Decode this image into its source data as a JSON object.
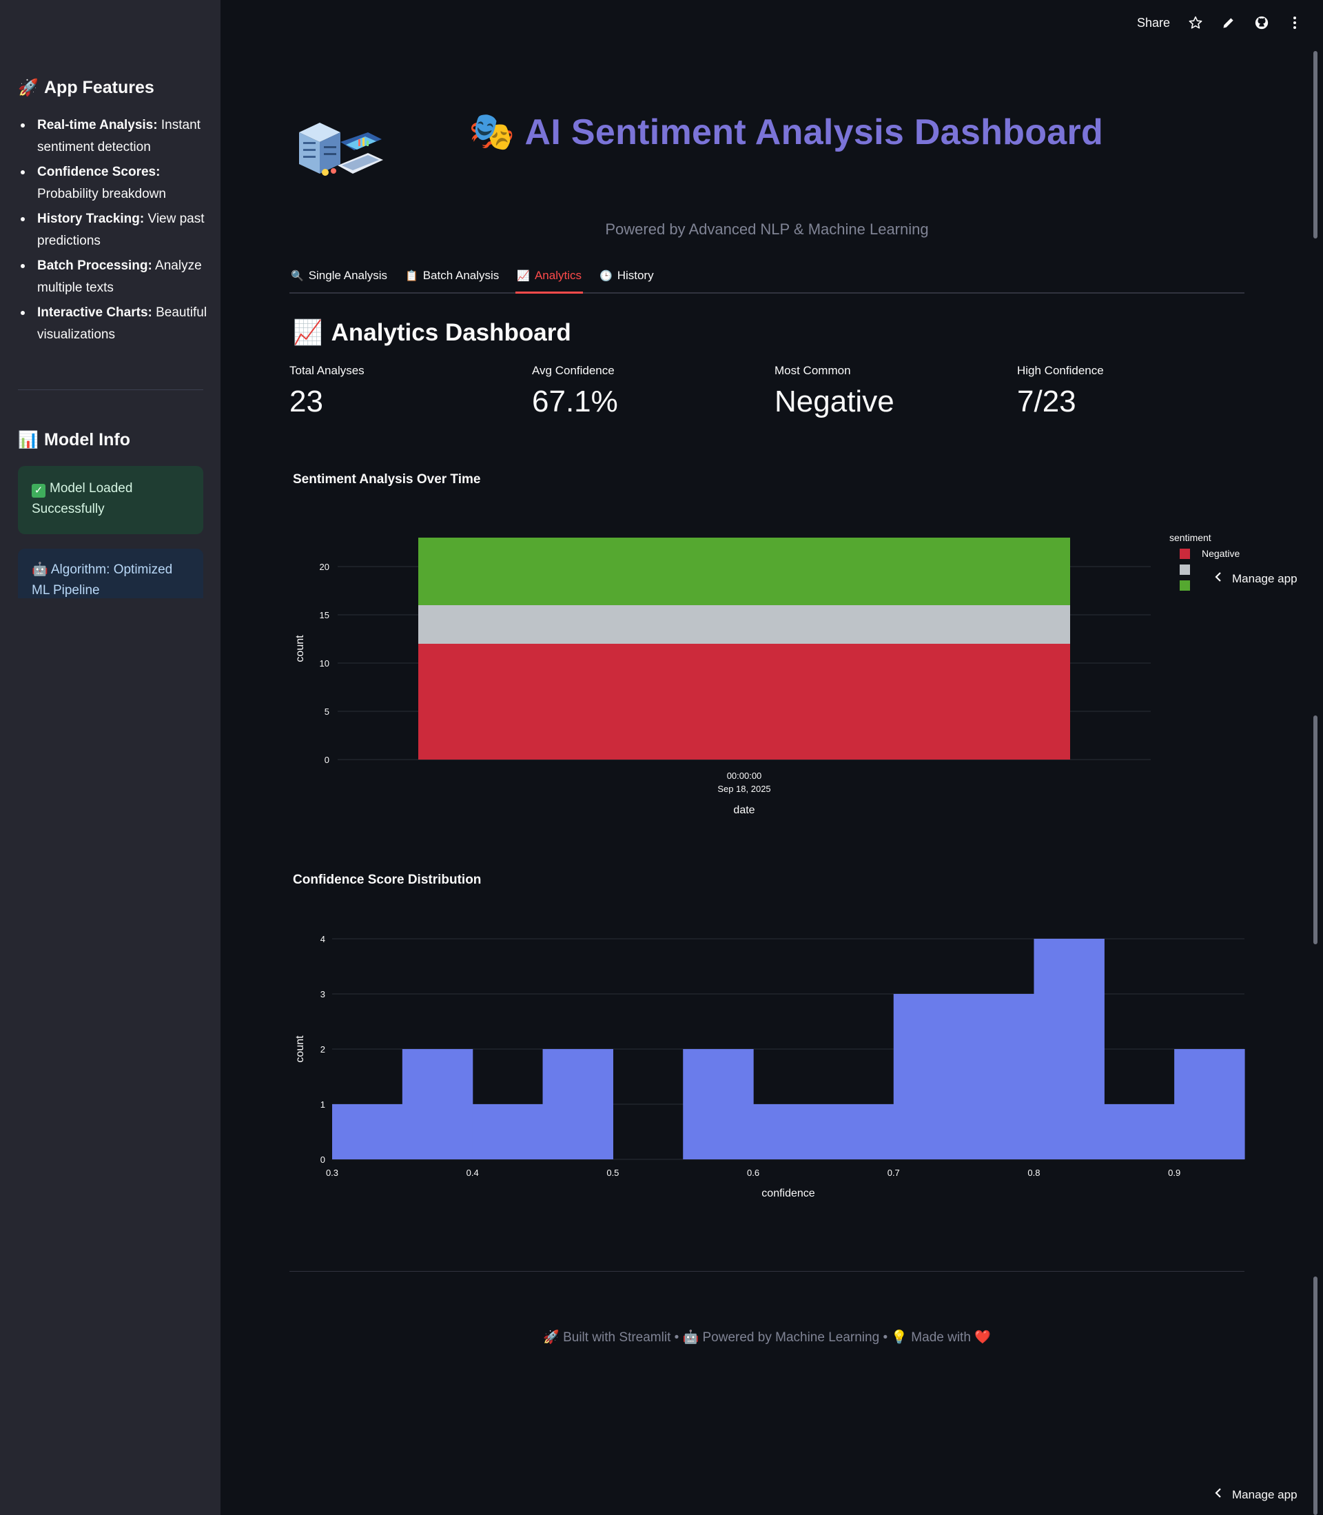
{
  "sidebar": {
    "features_heading": "App Features",
    "features_icon": "rocket-icon",
    "features": [
      {
        "title": "Real-time Analysis",
        "desc": " Instant sentiment detection"
      },
      {
        "title": "Confidence Scores",
        "desc": " Probability breakdown"
      },
      {
        "title": "History Tracking",
        "desc": " View past predictions"
      },
      {
        "title": "Batch Processing",
        "desc": " Analyze multiple texts"
      },
      {
        "title": "Interactive Charts",
        "desc": " Beautiful visualizations"
      }
    ],
    "model_heading": "Model Info",
    "model_icon": "bar-chart-icon",
    "status_success": "Model Loaded Successfully",
    "status_info": "🤖 Algorithm: Optimized ML Pipeline"
  },
  "topbar": {
    "share_label": "Share"
  },
  "header": {
    "title_icon": "🎭",
    "title": "AI Sentiment Analysis Dashboard",
    "subtitle": "Powered by Advanced NLP & Machine Learning",
    "title_color": "#7b74d8"
  },
  "tabs": [
    {
      "icon": "🔍",
      "label": "Single Analysis",
      "active": false
    },
    {
      "icon": "📋",
      "label": "Batch Analysis",
      "active": false
    },
    {
      "icon": "📈",
      "label": "Analytics",
      "active": true
    },
    {
      "icon": "🕒",
      "label": "History",
      "active": false
    }
  ],
  "analytics": {
    "section_icon": "📈",
    "section_title": "Analytics Dashboard",
    "metrics": [
      {
        "label": "Total Analyses",
        "value": "23"
      },
      {
        "label": "Avg Confidence",
        "value": "67.1%"
      },
      {
        "label": "Most Common",
        "value": "Negative"
      },
      {
        "label": "High Confidence",
        "value": "7/23"
      }
    ]
  },
  "charts": {
    "sentiment_title": "Sentiment Analysis Over Time",
    "confidence_title": "Confidence Score Distribution"
  },
  "chart_data": [
    {
      "type": "bar",
      "stacked": true,
      "title": "Sentiment Analysis Over Time",
      "xlabel": "date",
      "ylabel": "count",
      "categories": [
        "00:00:00\nSep 18, 2025"
      ],
      "ylim": [
        0,
        23
      ],
      "yticks": [
        0,
        5,
        10,
        15,
        20
      ],
      "legend_title": "sentiment",
      "legend_position": "right",
      "series": [
        {
          "name": "Negative",
          "values": [
            12
          ],
          "color": "#cc2a3b"
        },
        {
          "values": [
            4
          ],
          "color": "#bec3c8"
        },
        {
          "values": [
            7
          ],
          "color": "#55a830"
        }
      ]
    },
    {
      "type": "bar",
      "histogram": true,
      "title": "Confidence Score Distribution",
      "xlabel": "confidence",
      "ylabel": "count",
      "xlim": [
        0.3,
        0.95
      ],
      "ylim": [
        0,
        4
      ],
      "xticks": [
        0.3,
        0.4,
        0.5,
        0.6,
        0.7,
        0.8,
        0.9
      ],
      "yticks": [
        0,
        1,
        2,
        3,
        4
      ],
      "bin_width": 0.05,
      "bin_starts": [
        0.3,
        0.35,
        0.4,
        0.45,
        0.5,
        0.55,
        0.6,
        0.65,
        0.7,
        0.75,
        0.8,
        0.85,
        0.9
      ],
      "values": [
        1,
        2,
        1,
        2,
        0,
        2,
        1,
        1,
        3,
        3,
        4,
        1,
        2
      ],
      "color": "#6a7ceb"
    }
  ],
  "footer": {
    "text": "🚀 Built with Streamlit • 🤖 Powered by Machine Learning • 💡 Made with ❤️"
  },
  "manage_app": "Manage app"
}
